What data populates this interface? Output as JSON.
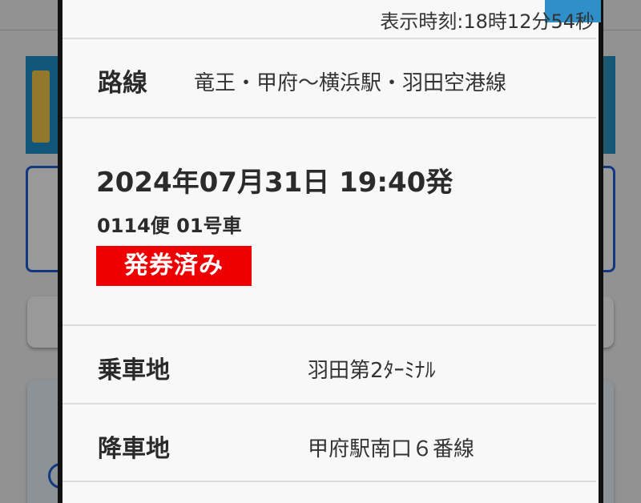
{
  "header": {
    "display_time": "表示時刻:18時12分54秒"
  },
  "route": {
    "label": "路線",
    "value": "竜王・甲府～横浜駅・羽田空港線"
  },
  "reservation": {
    "departure": "2024年07月31日 19:40発",
    "bus_info": "0114便 01号車",
    "status": "発券済み",
    "status_color": "#ee0000"
  },
  "boarding": {
    "label": "乗車地",
    "value": "羽田第2ﾀｰﾐﾅﾙ"
  },
  "alighting": {
    "label": "降車地",
    "value": "甲府駅南口６番線"
  },
  "colors": {
    "accent": "#2f8fc8",
    "border_blue": "#1f5fd6",
    "modal_bg": "#f8f8f8"
  }
}
